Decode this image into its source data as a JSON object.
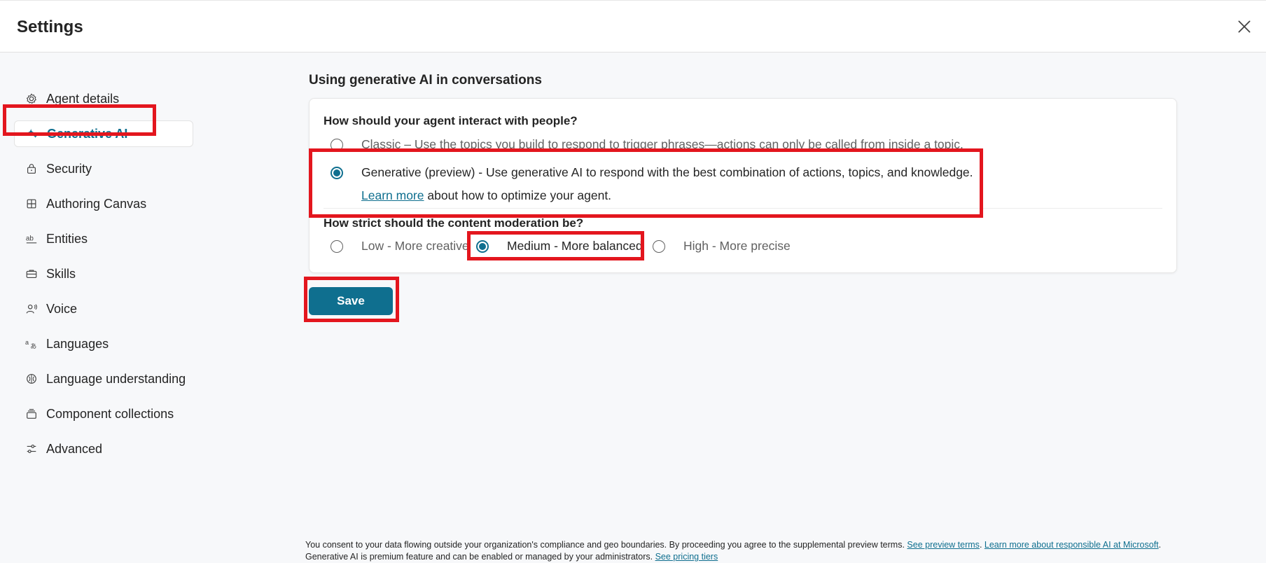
{
  "header": {
    "title": "Settings"
  },
  "sidebar": {
    "items": [
      {
        "label": "Agent details",
        "icon": "gear-icon"
      },
      {
        "label": "Generative AI",
        "icon": "sparkle-icon",
        "active": true
      },
      {
        "label": "Security",
        "icon": "lock-icon"
      },
      {
        "label": "Authoring Canvas",
        "icon": "grid-icon"
      },
      {
        "label": "Entities",
        "icon": "text-ab-icon"
      },
      {
        "label": "Skills",
        "icon": "toolbox-icon"
      },
      {
        "label": "Voice",
        "icon": "voice-person-icon"
      },
      {
        "label": "Languages",
        "icon": "translate-icon"
      },
      {
        "label": "Language understanding",
        "icon": "brain-icon"
      },
      {
        "label": "Component collections",
        "icon": "collection-icon"
      },
      {
        "label": "Advanced",
        "icon": "sliders-icon"
      }
    ]
  },
  "main": {
    "section_title": "Using generative AI in conversations",
    "interaction": {
      "question": "How should your agent interact with people?",
      "classic_label": "Classic – Use the topics you build to respond to trigger phrases—actions can only be called from inside a topic.",
      "generative_label": "Generative (preview) - Use generative AI to respond with the best combination of actions, topics, and knowledge.",
      "learn_more": "Learn more",
      "learn_more_suffix": "about how to optimize your agent.",
      "selected": "generative"
    },
    "moderation": {
      "question": "How strict should the content moderation be?",
      "options": [
        "Low - More creative",
        "Medium - More balanced",
        "High - More precise"
      ],
      "selected": "Medium - More balanced"
    },
    "save_label": "Save"
  },
  "footer": {
    "line1_text": "You consent to your data flowing outside your organization's compliance and geo boundaries. By proceeding you agree to the supplemental preview terms.",
    "see_preview_terms": "See preview terms",
    "responsible_ai": "Learn more about responsible AI at Microsoft",
    "line2_text": "Generative AI is premium feature and can be enabled or managed by your administrators.",
    "pricing": "See pricing tiers"
  },
  "colors": {
    "accent": "#0f6f8f",
    "highlight": "#e3161e"
  }
}
